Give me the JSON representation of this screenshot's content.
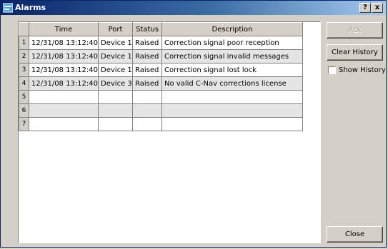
{
  "window": {
    "title": "Alarms",
    "help_label": "?",
    "close_label": "x"
  },
  "table": {
    "headers": [
      "Time",
      "Port",
      "Status",
      "Description"
    ],
    "rows": [
      {
        "num": "1",
        "time": "12/31/08 13:12:40",
        "port": "Device 1",
        "status": "Raised",
        "description": "Correction signal poor reception"
      },
      {
        "num": "2",
        "time": "12/31/08 13:12:40",
        "port": "Device 1",
        "status": "Raised",
        "description": "Correction signal invalid messages"
      },
      {
        "num": "3",
        "time": "12/31/08 13:12:40",
        "port": "Device 1",
        "status": "Raised",
        "description": "Correction signal lost lock"
      },
      {
        "num": "4",
        "time": "12/31/08 13:12:40",
        "port": "Device 3",
        "status": "Raised",
        "description": "No valid C-Nav corrections license"
      },
      {
        "num": "5",
        "time": "",
        "port": "",
        "status": "",
        "description": ""
      },
      {
        "num": "6",
        "time": "",
        "port": "",
        "status": "",
        "description": ""
      },
      {
        "num": "7",
        "time": "",
        "port": "",
        "status": "",
        "description": ""
      }
    ]
  },
  "buttons": {
    "ack_label": "Ack",
    "clear_history_label": "Clear History",
    "close_label": "Close"
  },
  "show_history": {
    "label": "Show History",
    "checked": false
  },
  "colors": {
    "titlebar_start": "#0a246a",
    "titlebar_end": "#a6caf0",
    "face": "#d4d0c8",
    "alt_row": "#e5e5e5"
  }
}
